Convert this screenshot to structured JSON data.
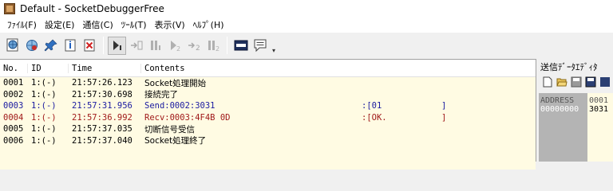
{
  "window": {
    "title": "Default - SocketDebuggerFree"
  },
  "menu": [
    "ﾌｧｲﾙ(F)",
    "設定(E)",
    "通信(C)",
    "ﾂｰﾙ(T)",
    "表示(V)",
    "ﾍﾙﾌﾟ(H)"
  ],
  "toolbar": {
    "icons": [
      "settings-globe-icon",
      "connect-globe-icon",
      "pin-icon",
      "info-doc-icon",
      "delete-doc-icon",
      "step-run-icon",
      "step-to-1-icon",
      "step-1-icon",
      "step-2-icon",
      "step-to-2-icon",
      "step-2b-icon",
      "terminal-icon",
      "message-icon"
    ]
  },
  "log": {
    "headers": {
      "no": "No.",
      "id": "ID",
      "time": "Time",
      "contents": "Contents"
    },
    "rows": [
      {
        "no": "0001",
        "id": "1:(-)",
        "time": "21:57:26.123",
        "contents": "Socket処理開始",
        "ascii_open": "",
        "ascii_close": "",
        "color": "black"
      },
      {
        "no": "0002",
        "id": "1:(-)",
        "time": "21:57:30.698",
        "contents": "接続完了",
        "ascii_open": "",
        "ascii_close": "",
        "color": "black"
      },
      {
        "no": "0003",
        "id": "1:(-)",
        "time": "21:57:31.956",
        "contents": "Send:0002:3031",
        "ascii_open": ":[01",
        "ascii_close": "]",
        "color": "blue"
      },
      {
        "no": "0004",
        "id": "1:(-)",
        "time": "21:57:36.992",
        "contents": "Recv:0003:4F4B 0D",
        "ascii_open": ":[OK.",
        "ascii_close": "]",
        "color": "red"
      },
      {
        "no": "0005",
        "id": "1:(-)",
        "time": "21:57:37.035",
        "contents": "切断信号受信",
        "ascii_open": "",
        "ascii_close": "",
        "color": "black"
      },
      {
        "no": "0006",
        "id": "1:(-)",
        "time": "21:57:37.040",
        "contents": "Socket処理終了",
        "ascii_open": "",
        "ascii_close": "",
        "color": "black"
      }
    ]
  },
  "editor": {
    "title": "送信ﾃﾞｰﾀｴﾃﾞｨﾀ",
    "address_header": "ADDRESS",
    "address_value": "00000000",
    "data_header": "0001",
    "data_value": "3031"
  }
}
